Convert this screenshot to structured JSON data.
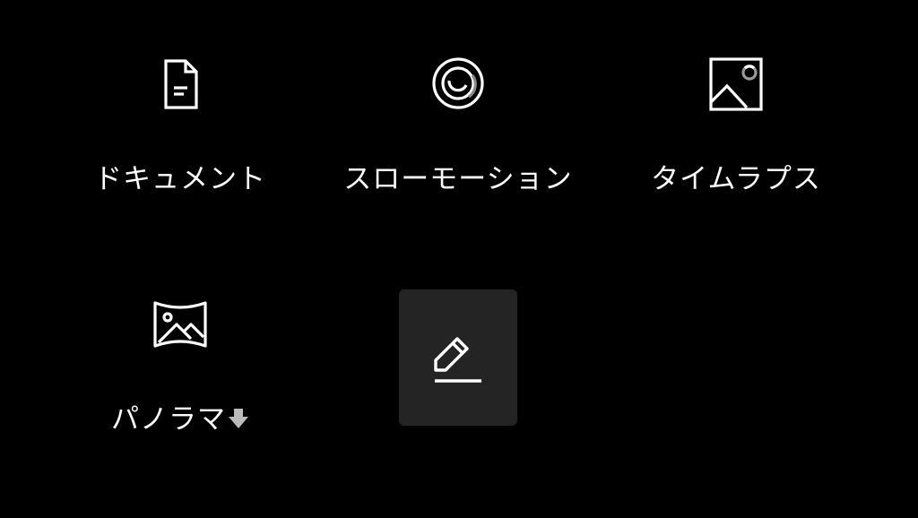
{
  "modes": [
    {
      "label": "ドキュメント",
      "icon": "document-icon"
    },
    {
      "label": "スローモーション",
      "icon": "slow-motion-icon"
    },
    {
      "label": "タイムラプス",
      "icon": "timelapse-icon"
    },
    {
      "label": "パノラマ",
      "icon": "panorama-icon",
      "badge_icon": "download-arrow-icon"
    }
  ],
  "edit": {
    "icon": "edit-pencil-icon"
  },
  "colors": {
    "background": "#000000",
    "foreground": "#ffffff",
    "edit_tile": "#242424",
    "badge": "#bbbbbb"
  }
}
